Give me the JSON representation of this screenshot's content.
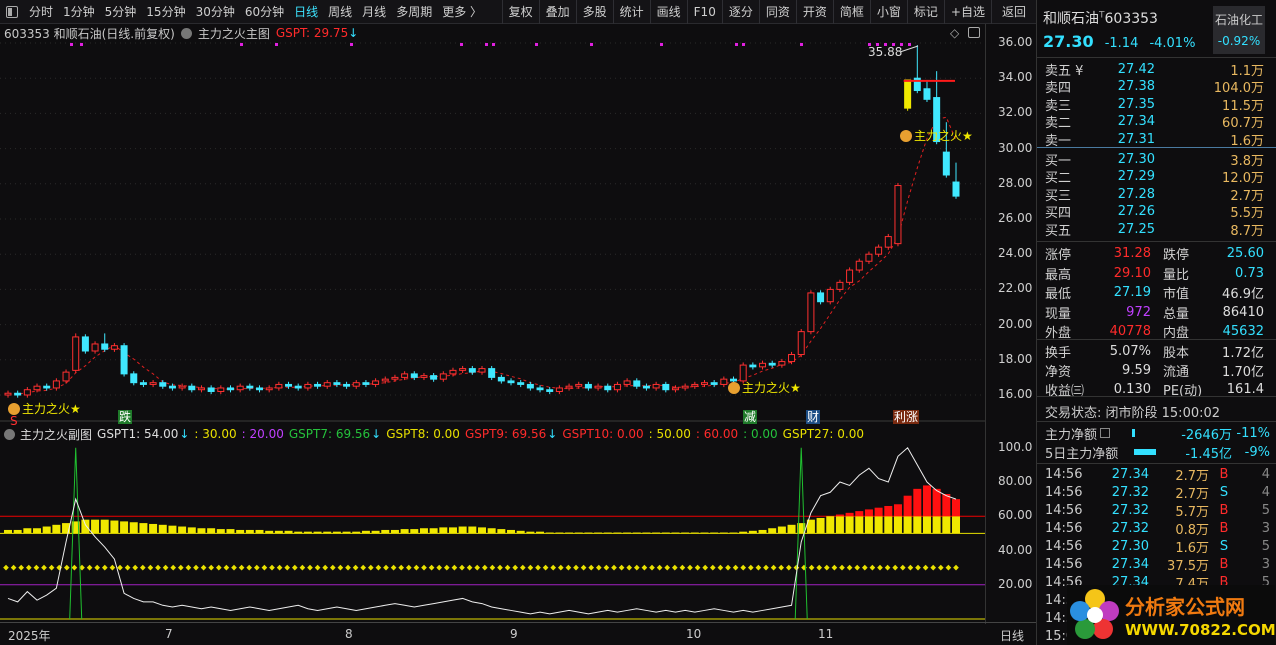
{
  "toolbar": {
    "periods": [
      {
        "label": "分时"
      },
      {
        "label": "1分钟"
      },
      {
        "label": "5分钟"
      },
      {
        "label": "15分钟"
      },
      {
        "label": "30分钟"
      },
      {
        "label": "60分钟"
      },
      {
        "label": "日线",
        "active": true
      },
      {
        "label": "周线"
      },
      {
        "label": "月线"
      },
      {
        "label": "多周期"
      },
      {
        "label": "更多 〉"
      }
    ],
    "buttons": [
      "复权",
      "叠加",
      "多股",
      "统计",
      "画线",
      "F10",
      "逐分",
      "同资",
      "开资",
      "简框",
      "小窗",
      "标记",
      "+自选",
      "返回"
    ]
  },
  "main": {
    "title": "603353 和顺石油(日线.前复权)",
    "indicator": "主力之火主图",
    "gspt": "GSPT: 29.75",
    "peak_label": "35.88",
    "signal_label": "主力之火★",
    "s_marker": "S",
    "markers": [
      {
        "text": "跌",
        "color": "#1f7a2a"
      },
      {
        "text": "减",
        "color": "#1f7a2a"
      },
      {
        "text": "财",
        "color": "#1d4e85"
      },
      {
        "text": "利涨",
        "color": "#7a2a10"
      }
    ],
    "price_ticks": [
      "36.00",
      "34.00",
      "32.00",
      "30.00",
      "28.00",
      "26.00",
      "24.00",
      "22.00",
      "20.00",
      "18.00",
      "16.00"
    ]
  },
  "sub": {
    "title": "主力之火副图",
    "values": [
      {
        "t": "GSPT1: 54.00",
        "c": "wh",
        "arrow": true
      },
      {
        "t": ": 30.00",
        "c": "yl"
      },
      {
        "t": ": 20.00",
        "c": "pu"
      },
      {
        "t": "GSPT7: 69.56",
        "c": "gr",
        "arrow": true
      },
      {
        "t": "GSPT8: 0.00",
        "c": "yl"
      },
      {
        "t": "GSPT9: 69.56",
        "c": "rd",
        "arrow": true
      },
      {
        "t": "GSPT10: 0.00",
        "c": "rd"
      },
      {
        "t": ": 50.00",
        "c": "yl"
      },
      {
        "t": ": 60.00",
        "c": "rd"
      },
      {
        "t": ": 0.00",
        "c": "gr"
      },
      {
        "t": "GSPT27: 0.00",
        "c": "yl"
      }
    ],
    "ticks": [
      "100.0",
      "80.00",
      "60.00",
      "40.00",
      "20.00"
    ]
  },
  "dates": [
    "2025年",
    "7",
    "8",
    "9",
    "10",
    "11"
  ],
  "period_label": "日线",
  "chart_data": {
    "type": "candlestick",
    "price_range": [
      16,
      36
    ],
    "closes": [
      16.1,
      16.0,
      16.3,
      16.5,
      16.4,
      16.8,
      17.3,
      19.3,
      18.5,
      18.9,
      18.6,
      18.8,
      17.2,
      16.7,
      16.6,
      16.7,
      16.5,
      16.4,
      16.5,
      16.3,
      16.4,
      16.2,
      16.4,
      16.3,
      16.5,
      16.4,
      16.3,
      16.4,
      16.6,
      16.5,
      16.4,
      16.6,
      16.5,
      16.7,
      16.6,
      16.5,
      16.7,
      16.6,
      16.8,
      16.9,
      17.0,
      17.2,
      17.0,
      17.1,
      16.9,
      17.2,
      17.4,
      17.5,
      17.3,
      17.5,
      17.0,
      16.8,
      16.7,
      16.6,
      16.4,
      16.3,
      16.2,
      16.4,
      16.5,
      16.6,
      16.4,
      16.5,
      16.3,
      16.6,
      16.8,
      16.5,
      16.4,
      16.6,
      16.3,
      16.4,
      16.5,
      16.6,
      16.7,
      16.6,
      16.9,
      16.8,
      17.7,
      17.6,
      17.8,
      17.7,
      17.9,
      18.3,
      19.6,
      21.8,
      21.3,
      22.0,
      22.4,
      23.1,
      23.6,
      24.0,
      24.4,
      25.0,
      27.9,
      33.9,
      33.3,
      32.8,
      30.4,
      28.5,
      27.3
    ],
    "open_overrides": {
      "7": 17.4,
      "92": 24.6,
      "93": 32.3,
      "94": 34.0,
      "95": 33.4,
      "96": 32.9,
      "97": 29.8,
      "98": 28.1
    },
    "high_overrides": {
      "7": 19.5,
      "10": 19.5,
      "93": 33.9,
      "94": 35.88,
      "95": 33.9,
      "96": 34.4,
      "97": 31.5,
      "98": 29.2
    },
    "limit_up_index": 93,
    "resistance": 33.85,
    "sub_line": [
      12,
      10,
      16,
      11,
      14,
      18,
      45,
      70,
      55,
      48,
      42,
      35,
      15,
      12,
      10,
      10,
      8,
      7,
      8,
      7,
      6,
      7,
      6,
      5,
      6,
      7,
      6,
      5,
      6,
      7,
      8,
      6,
      5,
      6,
      7,
      6,
      5,
      6,
      7,
      8,
      9,
      8,
      7,
      8,
      9,
      10,
      11,
      12,
      10,
      9,
      7,
      6,
      5,
      4,
      3,
      4,
      3,
      4,
      5,
      4,
      3,
      4,
      5,
      4,
      5,
      6,
      5,
      4,
      5,
      4,
      5,
      4,
      5,
      6,
      5,
      4,
      5,
      4,
      5,
      6,
      7,
      8,
      45,
      62,
      72,
      74,
      80,
      78,
      84,
      88,
      82,
      80,
      95,
      100,
      90,
      80,
      75,
      72,
      70
    ],
    "sub_bars": [
      52,
      52,
      53,
      53,
      54,
      55,
      56,
      57,
      58,
      58,
      58,
      57.5,
      57,
      56.5,
      56,
      55.5,
      55,
      54.5,
      54,
      53.5,
      53,
      53,
      52.5,
      52.5,
      52,
      52,
      52,
      51.5,
      51.5,
      51.5,
      51,
      51,
      51,
      51,
      51,
      51,
      51,
      51.5,
      51.5,
      52,
      52,
      52.5,
      52.5,
      53,
      53,
      53.5,
      53.5,
      54,
      54,
      53.5,
      53,
      52.5,
      52,
      51.5,
      51,
      51,
      50.5,
      50.5,
      50.5,
      50.5,
      50.5,
      50.5,
      50.5,
      50.5,
      50.5,
      50.5,
      50.5,
      50.5,
      50.5,
      50.5,
      50.5,
      50.5,
      50.5,
      50.5,
      50.5,
      50.5,
      51,
      51.5,
      52,
      53,
      54,
      55,
      56,
      58,
      59,
      60,
      61,
      62,
      63,
      64,
      65,
      66,
      67,
      72,
      76,
      78,
      76,
      73,
      70
    ],
    "spikes": [
      7,
      82
    ],
    "sub_range": [
      0,
      100
    ]
  },
  "quote": {
    "name": "和顺石油",
    "code": "603353",
    "t_mark": "T",
    "price": "27.30",
    "change": "-1.14",
    "pct": "-4.01%",
    "sector": "石油化工",
    "sector_pct": "-0.92%",
    "asks": [
      {
        "label": "卖五 ¥",
        "price": "27.42",
        "vol": "1.1万"
      },
      {
        "label": "卖四",
        "price": "27.38",
        "vol": "104.0万"
      },
      {
        "label": "卖三",
        "price": "27.35",
        "vol": "11.5万"
      },
      {
        "label": "卖二",
        "price": "27.34",
        "vol": "60.7万"
      },
      {
        "label": "卖一",
        "price": "27.31",
        "vol": "1.6万"
      }
    ],
    "bids": [
      {
        "label": "买一",
        "price": "27.30",
        "vol": "3.8万"
      },
      {
        "label": "买二",
        "price": "27.29",
        "vol": "12.0万"
      },
      {
        "label": "买三",
        "price": "27.28",
        "vol": "2.7万"
      },
      {
        "label": "买四",
        "price": "27.26",
        "vol": "5.5万"
      },
      {
        "label": "买五",
        "price": "27.25",
        "vol": "8.7万"
      }
    ],
    "stats": [
      {
        "k1": "涨停",
        "v1": "31.28",
        "c1": "rd",
        "k2": "跌停",
        "v2": "25.60",
        "c2": "cy"
      },
      {
        "k1": "最高",
        "v1": "29.10",
        "c1": "rd",
        "k2": "量比",
        "v2": "0.73",
        "c2": "cy"
      },
      {
        "k1": "最低",
        "v1": "27.19",
        "c1": "cy",
        "k2": "市值",
        "v2": "46.9亿",
        "c2": "wh"
      },
      {
        "k1": "现量",
        "v1": "972",
        "c1": "pu",
        "k2": "总量",
        "v2": "86410",
        "c2": "wh"
      },
      {
        "k1": "外盘",
        "v1": "40778",
        "c1": "rd",
        "k2": "内盘",
        "v2": "45632",
        "c2": "cy"
      }
    ],
    "stats2": [
      {
        "k1": "换手",
        "v1": "5.07%",
        "c1": "wh",
        "k2": "股本",
        "v2": "1.72亿",
        "c2": "wh"
      },
      {
        "k1": "净资",
        "v1": "9.59",
        "c1": "wh",
        "k2": "流通",
        "v2": "1.70亿",
        "c2": "wh"
      },
      {
        "k1": "收益㈢",
        "v1": "0.130",
        "c1": "wh",
        "k2": "PE(动)",
        "v2": "161.4",
        "c2": "wh"
      }
    ],
    "status": "交易状态: 闭市阶段 15:00:02",
    "flow1": {
      "label": "主力净额",
      "value": "-2646万",
      "pct": "-11%"
    },
    "flow5": {
      "label": "5日主力净额",
      "value": "-1.45亿",
      "pct": "-9%"
    },
    "trades": [
      {
        "t": "14:56",
        "p": "27.34",
        "v": "2.7万",
        "s": "B",
        "n": "4"
      },
      {
        "t": "14:56",
        "p": "27.32",
        "v": "2.7万",
        "s": "S",
        "n": "4"
      },
      {
        "t": "14:56",
        "p": "27.32",
        "v": "5.7万",
        "s": "B",
        "n": "5"
      },
      {
        "t": "14:56",
        "p": "27.32",
        "v": "0.8万",
        "s": "B",
        "n": "3"
      },
      {
        "t": "14:56",
        "p": "27.30",
        "v": "1.6万",
        "s": "S",
        "n": "5"
      },
      {
        "t": "14:56",
        "p": "27.34",
        "v": "37.5万",
        "s": "B",
        "n": "3"
      },
      {
        "t": "14:56",
        "p": "27.34",
        "v": "7.4万",
        "s": "B",
        "n": "5"
      },
      {
        "t": "14:5",
        "p": "",
        "v": "",
        "s": "",
        "n": ""
      },
      {
        "t": "14:5",
        "p": "",
        "v": "",
        "s": "",
        "n": ""
      },
      {
        "t": "15:0",
        "p": "",
        "v": "",
        "s": "",
        "n": ""
      }
    ]
  },
  "watermark": {
    "title": "分析家公式网",
    "url": "WWW.70822.COM"
  }
}
